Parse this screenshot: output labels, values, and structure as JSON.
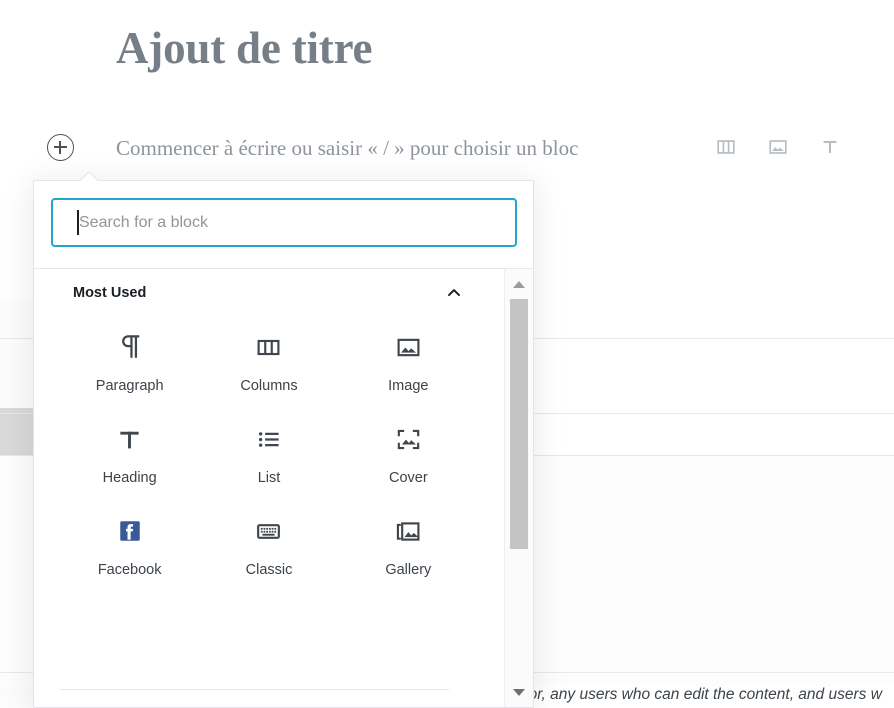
{
  "editor": {
    "post_title": "Ajout de titre",
    "block_placeholder": "Commencer à écrire ou saisir « / » pour choisir un bloc",
    "inserter_toggle_name": "plus-icon",
    "quick_inserters": [
      {
        "icon": "columns-icon",
        "label": "Columns"
      },
      {
        "icon": "image-icon",
        "label": "Image"
      },
      {
        "icon": "heading-icon",
        "label": "Heading"
      }
    ],
    "excerpt_fragment": "hor, any users who can edit the content, and users w"
  },
  "inserter": {
    "search": {
      "value": "",
      "placeholder": "Search for a block"
    },
    "panel": {
      "title": "Most Used",
      "collapse_icon": "chevron-up-icon",
      "expanded": true
    },
    "blocks": [
      {
        "label": "Paragraph",
        "icon": "paragraph-icon"
      },
      {
        "label": "Columns",
        "icon": "columns-icon"
      },
      {
        "label": "Image",
        "icon": "image-icon"
      },
      {
        "label": "Heading",
        "icon": "heading-icon"
      },
      {
        "label": "List",
        "icon": "list-icon"
      },
      {
        "label": "Cover",
        "icon": "cover-icon"
      },
      {
        "label": "Facebook",
        "icon": "facebook-icon"
      },
      {
        "label": "Classic",
        "icon": "classic-keyboard-icon"
      },
      {
        "label": "Gallery",
        "icon": "gallery-icon"
      }
    ],
    "scrollbar": {
      "up_icon": "scroll-up-arrow-icon",
      "down_icon": "scroll-down-arrow-icon"
    }
  },
  "colors": {
    "title_text": "#767e87",
    "placeholder_text": "#8d949c",
    "search_focus_border": "#1fa7cc",
    "facebook_blue": "#3b5998",
    "icon_dark": "#40464d",
    "popover_border": "#e2e4e7"
  }
}
